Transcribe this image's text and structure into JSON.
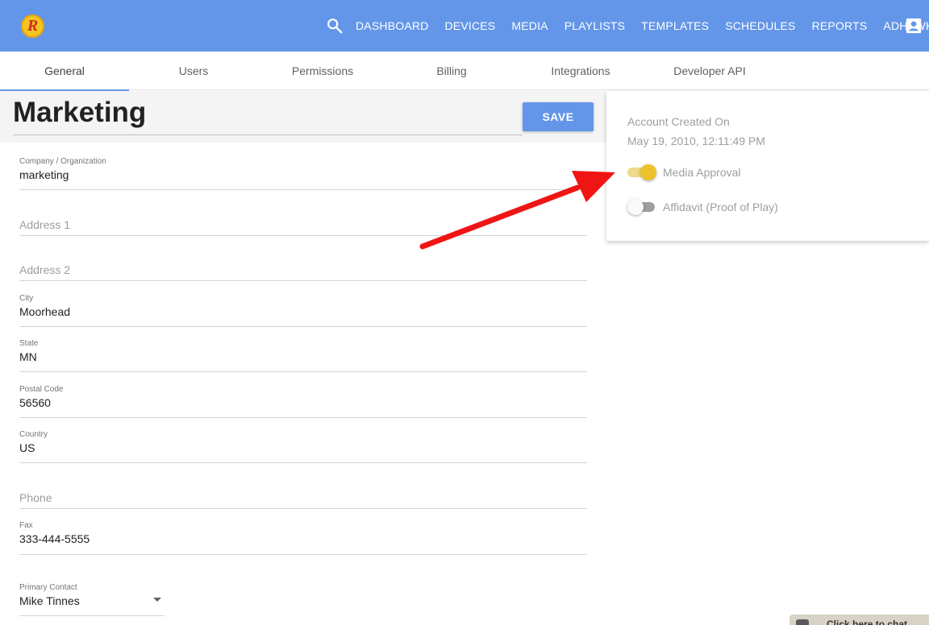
{
  "topbar": {
    "logo_letter": "R",
    "nav_items": [
      "DASHBOARD",
      "DEVICES",
      "MEDIA",
      "PLAYLISTS",
      "TEMPLATES",
      "SCHEDULES",
      "REPORTS",
      "ADHAWK"
    ],
    "color": "#6396e8"
  },
  "tabs": [
    "General",
    "Users",
    "Permissions",
    "Billing",
    "Integrations",
    "Developer API"
  ],
  "active_tab": "General",
  "page": {
    "title": "Marketing",
    "save_label": "SAVE"
  },
  "form": {
    "company": {
      "label": "Company / Organization",
      "value": "marketing"
    },
    "address1": {
      "placeholder": "Address 1"
    },
    "address2": {
      "placeholder": "Address 2"
    },
    "city": {
      "label": "City",
      "value": "Moorhead"
    },
    "state": {
      "label": "State",
      "value": "MN"
    },
    "postal": {
      "label": "Postal Code",
      "value": "56560"
    },
    "country": {
      "label": "Country",
      "value": "US"
    },
    "phone": {
      "placeholder": "Phone"
    },
    "fax": {
      "label": "Fax",
      "value": "333-444-5555"
    },
    "primary_contact": {
      "label": "Primary Contact",
      "value": "Mike Tinnes"
    }
  },
  "info_card": {
    "created_label": "Account Created On",
    "created_value": "May 19, 2010, 12:11:49 PM",
    "media_approval": {
      "label": "Media Approval",
      "enabled": true
    },
    "affidavit": {
      "label": "Affidavit (Proof of Play)",
      "enabled": false
    }
  },
  "chat": {
    "label": "Click here to chat"
  },
  "icons": [
    "logo-icon",
    "search-icon",
    "account-icon",
    "dropdown-arrow-icon",
    "chat-icon",
    "annotation-arrow-icon"
  ],
  "colors": {
    "accent": "#6396e8",
    "toggle_on": "#ecc22c",
    "annotation": "#f01515"
  }
}
